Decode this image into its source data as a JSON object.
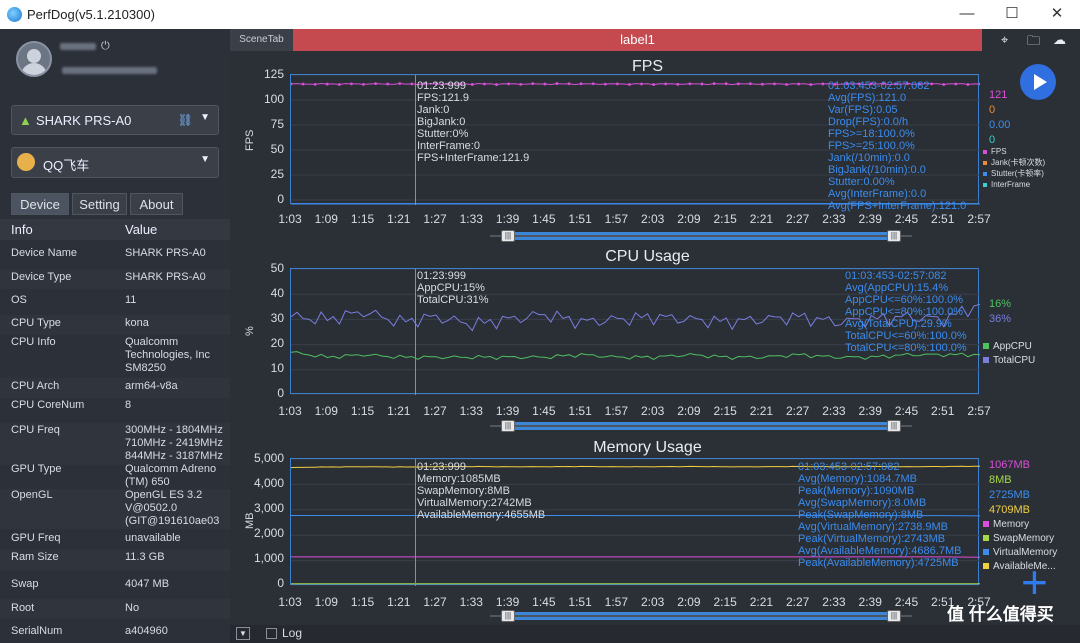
{
  "titlebar": {
    "title": "PerfDog(v5.1.210300)",
    "min": "—",
    "max": "☐",
    "close": "✕"
  },
  "device_select": {
    "label": "SHARK PRS-A0"
  },
  "app_select": {
    "label": "QQ飞车"
  },
  "tabs": [
    "Device",
    "Setting",
    "About"
  ],
  "info_header": {
    "k": "Info",
    "v": "Value"
  },
  "info_rows": [
    {
      "k": "Device Name",
      "v": "SHARK PRS-A0"
    },
    {
      "k": "Device Type",
      "v": "SHARK PRS-A0"
    },
    {
      "k": "OS",
      "v": "11"
    },
    {
      "k": "CPU Type",
      "v": "kona"
    },
    {
      "k": "CPU Info",
      "v": "Qualcomm\nTechnologies, Inc\nSM8250"
    },
    {
      "k": "CPU Arch",
      "v": "arm64-v8a"
    },
    {
      "k": "CPU CoreNum",
      "v": "8"
    },
    {
      "k": "CPU Freq",
      "v": "300MHz - 1804MHz\n710MHz - 2419MHz\n844MHz - 3187MHz"
    },
    {
      "k": "GPU Type",
      "v": "Qualcomm Adreno\n(TM) 650"
    },
    {
      "k": "OpenGL",
      "v": "OpenGL ES 3.2\nV@0502.0\n(GIT@191610ae03"
    },
    {
      "k": "GPU Freq",
      "v": "unavailable"
    },
    {
      "k": "Ram Size",
      "v": "11.3 GB"
    },
    {
      "k": "Swap",
      "v": "4047 MB"
    },
    {
      "k": "Root",
      "v": "No"
    },
    {
      "k": "SerialNum",
      "v": "a404960"
    }
  ],
  "scene_tab": "SceneTab",
  "label_tab": "label1",
  "bottom": {
    "log": "Log"
  },
  "watermark": "值 什么值得买",
  "x_ticks": [
    "1:03",
    "1:09",
    "1:15",
    "1:21",
    "1:27",
    "1:33",
    "1:39",
    "1:45",
    "1:51",
    "1:57",
    "2:03",
    "2:09",
    "2:15",
    "2:21",
    "2:27",
    "2:33",
    "2:39",
    "2:45",
    "2:51",
    "2:57"
  ],
  "fps": {
    "title": "FPS",
    "unit": "FPS",
    "y_ticks": [
      "125",
      "100",
      "75",
      "50",
      "25",
      "0"
    ],
    "cursor_text": "01:23:999\nFPS:121.9\nJank:0\nBigJank:0\nStutter:0%\nInterFrame:0\nFPS+InterFrame:121.9",
    "summary_text": "01:03:453-02:57:082\nAvg(FPS):121.0\nVar(FPS):0.05\nDrop(FPS):0.0/h\nFPS>=18:100.0%\nFPS>=25:100.0%\nJank(/10min):0.0\nBigJank(/10min):0.0\nStutter:0.00%\nAvg(InterFrame):0.0\nAvg(FPS+InterFrame):121.0",
    "values": [
      "121",
      "0",
      "0.00",
      "0"
    ],
    "legend": [
      "FPS",
      "Jank(卡顿次数)",
      "Stutter(卡顿率)",
      "InterFrame"
    ]
  },
  "cpu": {
    "title": "CPU Usage",
    "unit": "%",
    "y_ticks": [
      "50",
      "40",
      "30",
      "20",
      "10",
      "0"
    ],
    "cursor_text": "01:23:999\nAppCPU:15%\nTotalCPU:31%",
    "summary_text": "01:03:453-02:57:082\nAvg(AppCPU):15.4%\nAppCPU<=60%:100.0%\nAppCPU<=80%:100.0%\nAvg(TotalCPU):29.9%\nTotalCPU<=60%:100.0%\nTotalCPU<=80%:100.0%",
    "values": [
      "16%",
      "36%"
    ],
    "legend": [
      "AppCPU",
      "TotalCPU"
    ]
  },
  "mem": {
    "title": "Memory Usage",
    "unit": "MB",
    "y_ticks": [
      "5,000",
      "4,000",
      "3,000",
      "2,000",
      "1,000",
      "0"
    ],
    "cursor_text": "01:23:999\nMemory:1085MB\nSwapMemory:8MB\nVirtualMemory:2742MB\nAvailableMemory:4655MB",
    "summary_text": "01:03:453-02:57:082\nAvg(Memory):1084.7MB\nPeak(Memory):1090MB\nAvg(SwapMemory):8.0MB\nPeak(SwapMemory):8MB\nAvg(VirtualMemory):2738.9MB\nPeak(VirtualMemory):2743MB\nAvg(AvailableMemory):4686.7MB\nPeak(AvailableMemory):4725MB",
    "values": [
      "1067MB",
      "8MB",
      "2725MB",
      "4709MB"
    ],
    "legend": [
      "Memory",
      "SwapMemory",
      "VirtualMemory",
      "AvailableMe..."
    ]
  },
  "chart_data": [
    {
      "type": "line",
      "title": "FPS",
      "ylabel": "FPS",
      "ylim": [
        0,
        125
      ],
      "x": [
        "1:03",
        "1:09",
        "1:15",
        "1:21",
        "1:27",
        "1:33",
        "1:39",
        "1:45",
        "1:51",
        "1:57",
        "2:03",
        "2:09",
        "2:15",
        "2:21",
        "2:27",
        "2:33",
        "2:39",
        "2:45",
        "2:51",
        "2:57"
      ],
      "series": [
        {
          "name": "FPS",
          "values": [
            121,
            121,
            121,
            121,
            121,
            121,
            121,
            121,
            121,
            121,
            121,
            121,
            121,
            121,
            121,
            121,
            121,
            121,
            121,
            121
          ]
        },
        {
          "name": "Jank(卡顿次数)",
          "values": [
            0,
            0,
            0,
            0,
            0,
            0,
            0,
            0,
            0,
            0,
            0,
            0,
            0,
            0,
            0,
            0,
            0,
            0,
            0,
            0
          ]
        }
      ]
    },
    {
      "type": "line",
      "title": "CPU Usage",
      "ylabel": "%",
      "ylim": [
        0,
        50
      ],
      "x": [
        "1:03",
        "1:09",
        "1:15",
        "1:21",
        "1:27",
        "1:33",
        "1:39",
        "1:45",
        "1:51",
        "1:57",
        "2:03",
        "2:09",
        "2:15",
        "2:21",
        "2:27",
        "2:33",
        "2:39",
        "2:45",
        "2:51",
        "2:57"
      ],
      "series": [
        {
          "name": "AppCPU",
          "values": [
            17,
            15,
            16,
            15,
            15,
            15,
            15,
            15,
            16,
            15,
            15,
            16,
            15,
            15,
            16,
            15,
            15,
            16,
            16,
            16
          ]
        },
        {
          "name": "TotalCPU",
          "values": [
            31,
            30,
            33,
            29,
            31,
            28,
            30,
            32,
            29,
            30,
            31,
            30,
            29,
            30,
            31,
            29,
            30,
            31,
            30,
            36
          ]
        }
      ]
    },
    {
      "type": "line",
      "title": "Memory Usage",
      "ylabel": "MB",
      "ylim": [
        0,
        5000
      ],
      "x": [
        "1:03",
        "1:09",
        "1:15",
        "1:21",
        "1:27",
        "1:33",
        "1:39",
        "1:45",
        "1:51",
        "1:57",
        "2:03",
        "2:09",
        "2:15",
        "2:21",
        "2:27",
        "2:33",
        "2:39",
        "2:45",
        "2:51",
        "2:57"
      ],
      "series": [
        {
          "name": "Memory",
          "values": [
            1085,
            1085,
            1085,
            1085,
            1085,
            1085,
            1085,
            1085,
            1085,
            1085,
            1085,
            1085,
            1085,
            1085,
            1085,
            1085,
            1085,
            1085,
            1085,
            1067
          ]
        },
        {
          "name": "SwapMemory",
          "values": [
            8,
            8,
            8,
            8,
            8,
            8,
            8,
            8,
            8,
            8,
            8,
            8,
            8,
            8,
            8,
            8,
            8,
            8,
            8,
            8
          ]
        },
        {
          "name": "VirtualMemory",
          "values": [
            2742,
            2740,
            2740,
            2739,
            2739,
            2738,
            2738,
            2738,
            2738,
            2737,
            2737,
            2737,
            2737,
            2736,
            2736,
            2736,
            2736,
            2735,
            2735,
            2725
          ]
        },
        {
          "name": "AvailableMemory",
          "values": [
            4655,
            4680,
            4690,
            4680,
            4690,
            4700,
            4690,
            4690,
            4700,
            4690,
            4690,
            4700,
            4690,
            4690,
            4700,
            4690,
            4700,
            4690,
            4700,
            4709
          ]
        }
      ]
    }
  ]
}
